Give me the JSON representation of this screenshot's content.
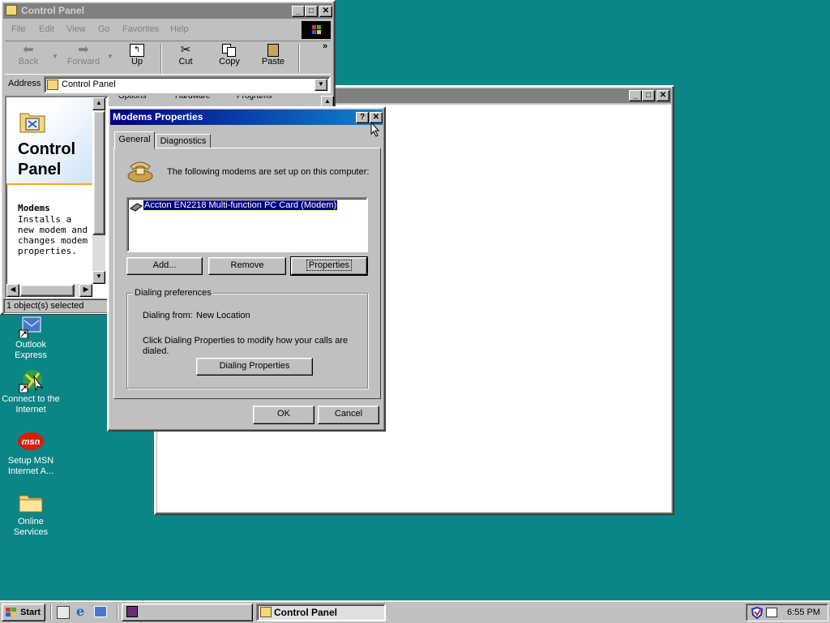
{
  "control_panel": {
    "title": "Control Panel",
    "menu": [
      "File",
      "Edit",
      "View",
      "Go",
      "Favorites",
      "Help"
    ],
    "toolbar": {
      "back": "Back",
      "forward": "Forward",
      "up": "Up",
      "cut": "Cut",
      "copy": "Copy",
      "paste": "Paste",
      "more": "»"
    },
    "address_label": "Address",
    "address_value": "Control Panel",
    "panel_title_line1": "Control",
    "panel_title_line2": "Panel",
    "item_name": "Modems",
    "item_desc": "Installs a new modem and changes modem properties.",
    "status": "1 object(s) selected",
    "partial_header": [
      "Options",
      "Hardware",
      "Programs"
    ]
  },
  "modems_dialog": {
    "title": "Modems Properties",
    "tabs": [
      "General",
      "Diagnostics"
    ],
    "intro": "The following modems are set up on this computer:",
    "modem_list": [
      "Accton EN2218 Multi-function PC Card (Modem)"
    ],
    "buttons": {
      "add": "Add...",
      "remove": "Remove",
      "properties": "Properties"
    },
    "group_label": "Dialing preferences",
    "dialing_from_label": "Dialing from:",
    "dialing_from_value": "New Location",
    "dialing_hint": "Click Dialing Properties to modify how your calls are dialed.",
    "dialing_properties_button": "Dialing Properties",
    "ok": "OK",
    "cancel": "Cancel"
  },
  "desktop_icons": [
    {
      "label": "Outlook Express",
      "icon": "outlook-express-icon"
    },
    {
      "label": "Connect to the Internet",
      "icon": "connect-internet-icon"
    },
    {
      "label": "Setup MSN Internet A...",
      "icon": "msn-icon"
    },
    {
      "label": "Online Services",
      "icon": "folder-icon"
    }
  ],
  "taskbar": {
    "start": "Start",
    "task_control_panel": "Control Panel",
    "clock": "6:55 PM"
  },
  "colors": {
    "desktop": "#0b8585",
    "title_active_start": "#000080",
    "title_active_end": "#1084d0",
    "title_inactive": "#808080"
  }
}
